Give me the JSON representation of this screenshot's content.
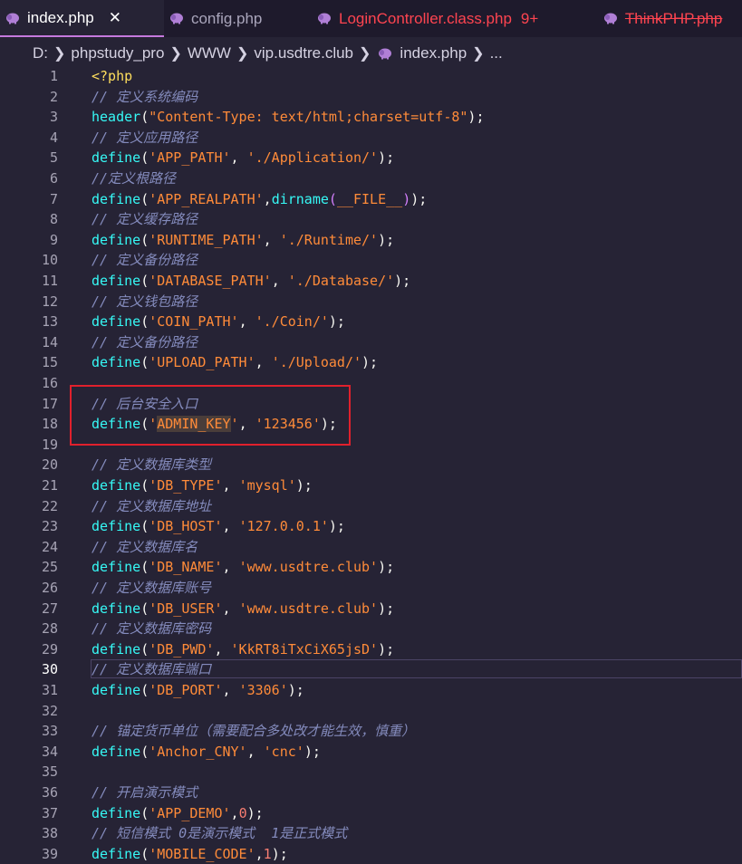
{
  "tabs": [
    {
      "label": "index.php",
      "close": "✕",
      "active": true
    },
    {
      "label": "config.php"
    },
    {
      "label": "LoginController.class.php",
      "badge": "9+"
    },
    {
      "label": "ThinkPHP.php"
    }
  ],
  "breadcrumb": [
    "D:",
    "phpstudy_pro",
    "WWW",
    "vip.usdtre.club",
    "index.php",
    "..."
  ],
  "editor": {
    "current_line": 30,
    "lines": [
      {
        "n": 1,
        "t": [
          [
            "kw",
            "<?php"
          ]
        ]
      },
      {
        "n": 2,
        "t": [
          [
            "cm",
            "// 定义系统编码"
          ]
        ]
      },
      {
        "n": 3,
        "t": [
          [
            "fn",
            "header"
          ],
          [
            "pu",
            "("
          ],
          [
            "str",
            "\"Content-Type: text/html;charset=utf-8\""
          ],
          [
            "pu",
            ");"
          ]
        ]
      },
      {
        "n": 4,
        "t": [
          [
            "cm",
            "// 定义应用路径"
          ]
        ]
      },
      {
        "n": 5,
        "t": [
          [
            "fn",
            "define"
          ],
          [
            "pu",
            "("
          ],
          [
            "str",
            "'APP_PATH'"
          ],
          [
            "pu",
            ", "
          ],
          [
            "str",
            "'./Application/'"
          ],
          [
            "pu",
            ");"
          ]
        ]
      },
      {
        "n": 6,
        "t": [
          [
            "cm",
            "//定义根路径"
          ]
        ]
      },
      {
        "n": 7,
        "t": [
          [
            "fn",
            "define"
          ],
          [
            "pu",
            "("
          ],
          [
            "str",
            "'APP_REALPATH'"
          ],
          [
            "pu",
            ","
          ],
          [
            "fn",
            "dirname"
          ],
          [
            "mg",
            "("
          ],
          [
            "str",
            "__FILE__"
          ],
          [
            "mg",
            ")"
          ],
          [
            "pu",
            ");"
          ]
        ]
      },
      {
        "n": 8,
        "t": [
          [
            "cm",
            "// 定义缓存路径"
          ]
        ]
      },
      {
        "n": 9,
        "t": [
          [
            "fn",
            "define"
          ],
          [
            "pu",
            "("
          ],
          [
            "str",
            "'RUNTIME_PATH'"
          ],
          [
            "pu",
            ", "
          ],
          [
            "str",
            "'./Runtime/'"
          ],
          [
            "pu",
            ");"
          ]
        ]
      },
      {
        "n": 10,
        "t": [
          [
            "cm",
            "// 定义备份路径"
          ]
        ]
      },
      {
        "n": 11,
        "t": [
          [
            "fn",
            "define"
          ],
          [
            "pu",
            "("
          ],
          [
            "str",
            "'DATABASE_PATH'"
          ],
          [
            "pu",
            ", "
          ],
          [
            "str",
            "'./Database/'"
          ],
          [
            "pu",
            ");"
          ]
        ]
      },
      {
        "n": 12,
        "t": [
          [
            "cm",
            "// 定义钱包路径"
          ]
        ]
      },
      {
        "n": 13,
        "t": [
          [
            "fn",
            "define"
          ],
          [
            "pu",
            "("
          ],
          [
            "str",
            "'COIN_PATH'"
          ],
          [
            "pu",
            ", "
          ],
          [
            "str",
            "'./Coin/'"
          ],
          [
            "pu",
            ");"
          ]
        ]
      },
      {
        "n": 14,
        "t": [
          [
            "cm",
            "// 定义备份路径"
          ]
        ]
      },
      {
        "n": 15,
        "t": [
          [
            "fn",
            "define"
          ],
          [
            "pu",
            "("
          ],
          [
            "str",
            "'UPLOAD_PATH'"
          ],
          [
            "pu",
            ", "
          ],
          [
            "str",
            "'./Upload/'"
          ],
          [
            "pu",
            ");"
          ]
        ]
      },
      {
        "n": 16,
        "t": []
      },
      {
        "n": 17,
        "t": [
          [
            "cm",
            "// 后台安全入口"
          ]
        ]
      },
      {
        "n": 18,
        "t": [
          [
            "fn",
            "define"
          ],
          [
            "pu",
            "("
          ],
          [
            "str",
            "'"
          ],
          [
            "str hl",
            "ADMIN_KEY"
          ],
          [
            "str",
            "'"
          ],
          [
            "pu",
            ", "
          ],
          [
            "str",
            "'123456'"
          ],
          [
            "pu",
            ");"
          ]
        ]
      },
      {
        "n": 19,
        "t": []
      },
      {
        "n": 20,
        "t": [
          [
            "cm",
            "// 定义数据库类型"
          ]
        ]
      },
      {
        "n": 21,
        "t": [
          [
            "fn",
            "define"
          ],
          [
            "pu",
            "("
          ],
          [
            "str",
            "'DB_TYPE'"
          ],
          [
            "pu",
            ", "
          ],
          [
            "str",
            "'mysql'"
          ],
          [
            "pu",
            ");"
          ]
        ]
      },
      {
        "n": 22,
        "t": [
          [
            "cm",
            "// 定义数据库地址"
          ]
        ]
      },
      {
        "n": 23,
        "t": [
          [
            "fn",
            "define"
          ],
          [
            "pu",
            "("
          ],
          [
            "str",
            "'DB_HOST'"
          ],
          [
            "pu",
            ", "
          ],
          [
            "str",
            "'127.0.0.1'"
          ],
          [
            "pu",
            ");"
          ]
        ]
      },
      {
        "n": 24,
        "t": [
          [
            "cm",
            "// 定义数据库名"
          ]
        ]
      },
      {
        "n": 25,
        "t": [
          [
            "fn",
            "define"
          ],
          [
            "pu",
            "("
          ],
          [
            "str",
            "'DB_NAME'"
          ],
          [
            "pu",
            ", "
          ],
          [
            "str",
            "'www.usdtre.club'"
          ],
          [
            "pu",
            ");"
          ]
        ]
      },
      {
        "n": 26,
        "t": [
          [
            "cm",
            "// 定义数据库账号"
          ]
        ]
      },
      {
        "n": 27,
        "t": [
          [
            "fn",
            "define"
          ],
          [
            "pu",
            "("
          ],
          [
            "str",
            "'DB_USER'"
          ],
          [
            "pu",
            ", "
          ],
          [
            "str",
            "'www.usdtre.club'"
          ],
          [
            "pu",
            ");"
          ]
        ]
      },
      {
        "n": 28,
        "t": [
          [
            "cm",
            "// 定义数据库密码"
          ]
        ]
      },
      {
        "n": 29,
        "t": [
          [
            "fn",
            "define"
          ],
          [
            "pu",
            "("
          ],
          [
            "str",
            "'DB_PWD'"
          ],
          [
            "pu",
            ", "
          ],
          [
            "str",
            "'KkRT8iTxCiX65jsD'"
          ],
          [
            "pu",
            ");"
          ]
        ]
      },
      {
        "n": 30,
        "t": [
          [
            "cm",
            "// 定义数据库端口"
          ]
        ]
      },
      {
        "n": 31,
        "t": [
          [
            "fn",
            "define"
          ],
          [
            "pu",
            "("
          ],
          [
            "str",
            "'DB_PORT'"
          ],
          [
            "pu",
            ", "
          ],
          [
            "str",
            "'3306'"
          ],
          [
            "pu",
            ");"
          ]
        ]
      },
      {
        "n": 32,
        "t": []
      },
      {
        "n": 33,
        "t": [
          [
            "cm",
            "// 锚定货币单位（需要配合多处改才能生效，慎重）"
          ]
        ]
      },
      {
        "n": 34,
        "t": [
          [
            "fn",
            "define"
          ],
          [
            "pu",
            "("
          ],
          [
            "str",
            "'Anchor_CNY'"
          ],
          [
            "pu",
            ", "
          ],
          [
            "str",
            "'cnc'"
          ],
          [
            "pu",
            ");"
          ]
        ]
      },
      {
        "n": 35,
        "t": []
      },
      {
        "n": 36,
        "t": [
          [
            "cm",
            "// 开启演示模式"
          ]
        ]
      },
      {
        "n": 37,
        "t": [
          [
            "fn",
            "define"
          ],
          [
            "pu",
            "("
          ],
          [
            "str",
            "'APP_DEMO'"
          ],
          [
            "pu",
            ","
          ],
          [
            "num",
            "0"
          ],
          [
            "pu",
            ");"
          ]
        ]
      },
      {
        "n": 38,
        "t": [
          [
            "cm",
            "// 短信模式 0是演示模式  1是正式模式"
          ]
        ]
      },
      {
        "n": 39,
        "t": [
          [
            "fn",
            "define"
          ],
          [
            "pu",
            "("
          ],
          [
            "str",
            "'MOBILE_CODE'"
          ],
          [
            "pu",
            ","
          ],
          [
            "num",
            "1"
          ],
          [
            "pu",
            ");"
          ]
        ]
      }
    ]
  },
  "colors": {
    "accent": "#c679dd",
    "highlight_box": "#e0202c",
    "error": "#fe4450"
  }
}
